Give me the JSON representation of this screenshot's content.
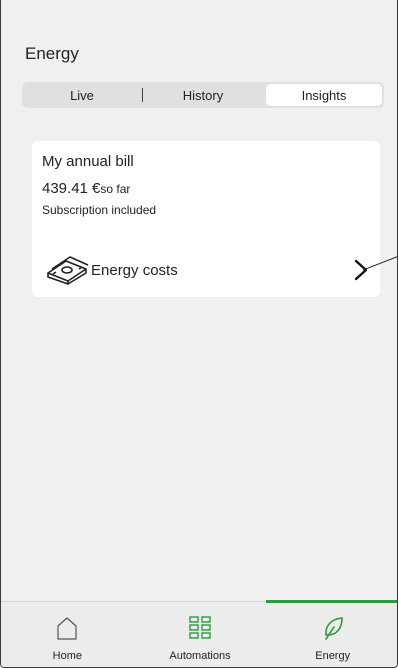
{
  "header": {
    "title": "Energy"
  },
  "segments": [
    {
      "label": "Live",
      "active": false
    },
    {
      "label": "History",
      "active": false
    },
    {
      "label": "Insights",
      "active": true
    }
  ],
  "card": {
    "title": "My annual bill",
    "amount": "439.41 €",
    "amount_suffix": "so far",
    "subtitle": "Subscription included",
    "row": {
      "label": "Energy costs",
      "icon": "money-icon",
      "chevron": "chevron-right-icon"
    }
  },
  "tabbar": {
    "items": [
      {
        "label": "Home",
        "icon": "home-icon",
        "active": false
      },
      {
        "label": "Automations",
        "icon": "grid-icon",
        "active": false
      },
      {
        "label": "Energy",
        "icon": "leaf-icon",
        "active": true
      }
    ],
    "accent_color": "#2a9c3c"
  }
}
